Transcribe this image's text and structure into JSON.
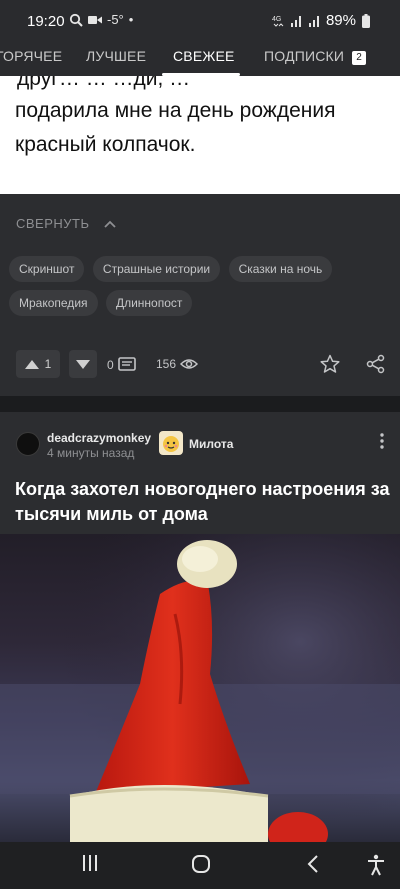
{
  "status_bar": {
    "time": "19:20",
    "temperature": "-5°",
    "battery": "89%",
    "icons": [
      "search-icon",
      "video-icon",
      "notification-dot",
      "4g-icon",
      "signal-icon",
      "signal-icon",
      "battery-icon"
    ]
  },
  "tabs": [
    {
      "label": "ГОРЯЧЕЕ",
      "active": false
    },
    {
      "label": "ЛУЧШЕЕ",
      "active": false
    },
    {
      "label": "СВЕЖЕЕ",
      "active": true
    },
    {
      "label": "ПОДПИСКИ",
      "active": false,
      "badge": "2"
    }
  ],
  "story": {
    "cut_line": "друг… … …ди, …",
    "lines": [
      "подарила мне на день рождения",
      "красный колпачок."
    ]
  },
  "post_footer": {
    "collapse_label": "СВЕРНУТЬ",
    "tags": [
      "Скриншот",
      "Страшные истории",
      "Сказки на ночь",
      "Мракопедия",
      "Длиннопост"
    ],
    "rating": "1",
    "comments": "0",
    "views": "156"
  },
  "post2": {
    "author": "deadcrazymonkey",
    "time_ago": "4 минуты назад",
    "community": "Милота",
    "title": "Когда захотел новогоднего настроения за тысячи миль от дома"
  },
  "nav_bar": {
    "buttons": [
      "recents-icon",
      "home-icon",
      "back-icon",
      "accessibility-icon"
    ]
  }
}
